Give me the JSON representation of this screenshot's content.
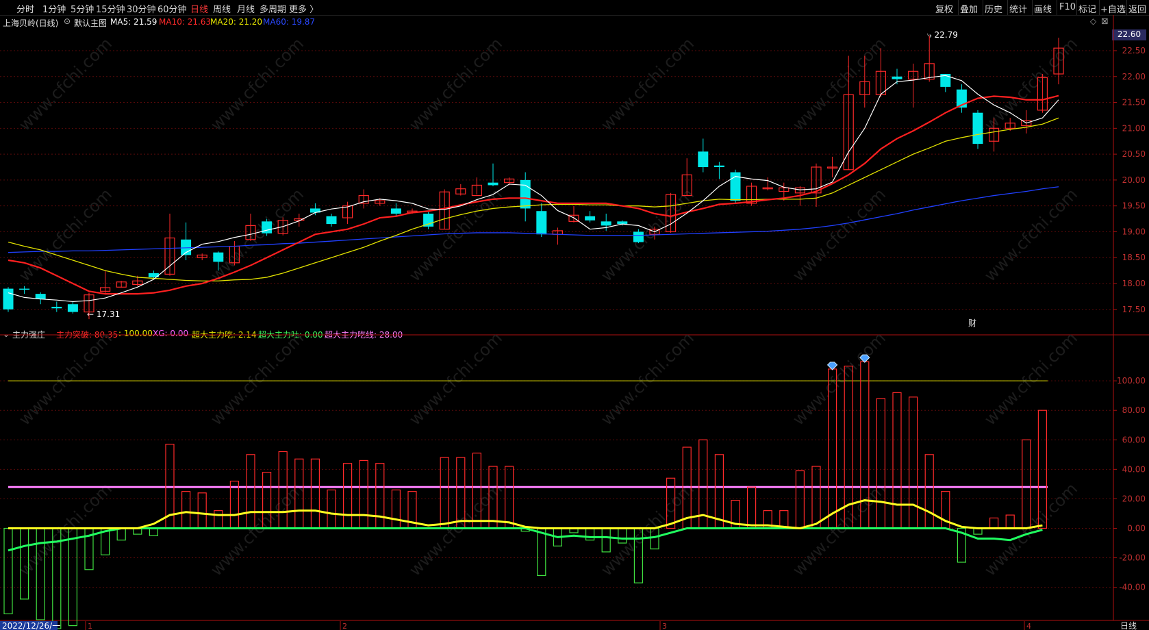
{
  "toolbar": {
    "periods": [
      "分时",
      "1分钟",
      "5分钟",
      "15分钟",
      "30分钟",
      "60分钟",
      "日线",
      "周线",
      "月线",
      "多周期",
      "更多 〉"
    ],
    "active_period": "日线",
    "tools": [
      "复权",
      "叠加",
      "历史",
      "统计",
      "画线",
      "F10",
      "标记",
      "+自选",
      "返回"
    ]
  },
  "main_header": {
    "name": "上海贝岭(日线)",
    "template": "默认主图",
    "ma5": "MA5: 21.59",
    "ma10": "MA10: 21.63",
    "ma20": "MA20: 21.20",
    "ma60": "MA60: 19.87"
  },
  "sub_header": {
    "name": "主力强庄",
    "main_break": "主力突破: 80.35",
    "main_break2": ": 100.00",
    "xg": "XG: 0.00",
    "eat": "超大主力吃: 2.14",
    "spit": "超大主力吐: 0.00",
    "eat_line": "超大主力吃线: 28.00"
  },
  "annotations": {
    "high": "22.79",
    "low": "17.31",
    "price_tag": "22.60",
    "cai": "财"
  },
  "price_axis": [
    "22.50",
    "22.00",
    "21.50",
    "21.00",
    "20.50",
    "20.00",
    "19.50",
    "19.00",
    "18.50",
    "18.00",
    "17.50"
  ],
  "osc_axis": [
    "100.00",
    "80.00",
    "60.00",
    "40.00",
    "20.00",
    "0.00",
    "-20.00",
    "-40.00"
  ],
  "date_axis": {
    "start": "2022/12/26/一",
    "m1": "1",
    "m2": "2",
    "m3": "3",
    "m4": "4",
    "period_label": "日线"
  },
  "watermark": "www.cfchi.com",
  "colors": {
    "up": "#ff2a2a",
    "down": "#00e8e8",
    "ma5": "#ffffff",
    "ma10": "#ff2020",
    "ma20": "#e0e000",
    "ma60": "#2040ff",
    "eat_line": "#ff80ff",
    "pos_bar": "#ff2a2a",
    "neg_bar": "#40e040"
  },
  "chart_data": {
    "type": "candlestick",
    "candles": [
      [
        17.9,
        17.5,
        17.93,
        17.45
      ],
      [
        17.9,
        17.88,
        17.95,
        17.8
      ],
      [
        17.8,
        17.7,
        17.83,
        17.6
      ],
      [
        17.55,
        17.52,
        17.65,
        17.45
      ],
      [
        17.6,
        17.45,
        17.65,
        17.42
      ],
      [
        17.45,
        17.78,
        17.82,
        17.31
      ],
      [
        17.85,
        17.92,
        18.25,
        17.8
      ],
      [
        17.93,
        18.03,
        18.05,
        17.92
      ],
      [
        17.98,
        18.05,
        18.15,
        17.95
      ],
      [
        18.2,
        18.12,
        18.25,
        18.08
      ],
      [
        18.18,
        18.88,
        19.35,
        18.15
      ],
      [
        18.85,
        18.55,
        19.18,
        18.45
      ],
      [
        18.5,
        18.55,
        18.58,
        18.45
      ],
      [
        18.6,
        18.42,
        18.62,
        18.25
      ],
      [
        18.4,
        18.72,
        18.82,
        18.35
      ],
      [
        18.85,
        19.12,
        19.35,
        18.82
      ],
      [
        19.2,
        18.97,
        19.25,
        18.92
      ],
      [
        18.97,
        19.22,
        19.28,
        18.93
      ],
      [
        19.22,
        19.25,
        19.35,
        19.1
      ],
      [
        19.45,
        19.37,
        19.55,
        19.32
      ],
      [
        19.3,
        19.15,
        19.35,
        19.1
      ],
      [
        19.27,
        19.5,
        19.58,
        19.15
      ],
      [
        19.55,
        19.7,
        19.82,
        19.45
      ],
      [
        19.55,
        19.6,
        19.65,
        19.5
      ],
      [
        19.45,
        19.35,
        19.55,
        19.3
      ],
      [
        19.37,
        19.4,
        19.45,
        19.35
      ],
      [
        19.35,
        19.1,
        19.38,
        19.05
      ],
      [
        19.05,
        19.77,
        19.82,
        19.05
      ],
      [
        19.73,
        19.83,
        19.92,
        19.7
      ],
      [
        19.7,
        19.9,
        20.05,
        19.72
      ],
      [
        19.95,
        19.9,
        20.32,
        19.88
      ],
      [
        19.95,
        20.02,
        20.05,
        19.9
      ],
      [
        20.0,
        19.45,
        20.15,
        19.2
      ],
      [
        19.4,
        18.95,
        19.55,
        18.9
      ],
      [
        18.95,
        19.02,
        19.08,
        18.75
      ],
      [
        19.2,
        19.32,
        19.5,
        19.18
      ],
      [
        19.3,
        19.22,
        19.4,
        19.18
      ],
      [
        19.2,
        19.12,
        19.35,
        19.02
      ],
      [
        19.2,
        19.15,
        19.22,
        19.12
      ],
      [
        19.0,
        18.8,
        19.05,
        18.78
      ],
      [
        18.95,
        19.05,
        19.1,
        18.85
      ],
      [
        19.0,
        19.72,
        19.75,
        18.98
      ],
      [
        19.7,
        20.1,
        20.42,
        19.7
      ],
      [
        20.55,
        20.25,
        20.8,
        20.15
      ],
      [
        20.28,
        20.25,
        20.35,
        20.02
      ],
      [
        20.15,
        19.6,
        20.2,
        19.55
      ],
      [
        19.55,
        19.88,
        19.95,
        19.5
      ],
      [
        19.85,
        19.85,
        20.05,
        19.8
      ],
      [
        19.78,
        19.85,
        19.95,
        19.6
      ],
      [
        19.75,
        19.85,
        19.88,
        19.5
      ],
      [
        19.75,
        20.25,
        20.32,
        19.48
      ],
      [
        20.25,
        20.25,
        20.45,
        20.05
      ],
      [
        20.2,
        21.65,
        22.4,
        20.2
      ],
      [
        21.65,
        21.9,
        22.4,
        21.4
      ],
      [
        21.65,
        22.1,
        22.55,
        21.6
      ],
      [
        22.0,
        21.95,
        22.15,
        21.85
      ],
      [
        21.95,
        22.1,
        22.25,
        21.4
      ],
      [
        21.95,
        22.25,
        22.79,
        21.9
      ],
      [
        22.05,
        21.8,
        22.05,
        21.7
      ],
      [
        21.75,
        21.4,
        21.85,
        21.3
      ],
      [
        21.3,
        20.7,
        21.35,
        20.6
      ],
      [
        20.75,
        21.0,
        21.2,
        20.55
      ],
      [
        21.0,
        21.1,
        21.2,
        20.95
      ],
      [
        21.05,
        21.15,
        21.35,
        20.9
      ],
      [
        21.35,
        21.98,
        22.05,
        21.3
      ],
      [
        22.05,
        22.55,
        22.75,
        21.85
      ]
    ],
    "ma5": [
      17.82,
      17.73,
      17.7,
      17.68,
      17.65,
      17.67,
      17.72,
      17.82,
      17.93,
      18.08,
      18.34,
      18.6,
      18.76,
      18.81,
      18.89,
      18.95,
      19.03,
      19.1,
      19.21,
      19.37,
      19.44,
      19.48,
      19.58,
      19.63,
      19.6,
      19.55,
      19.44,
      19.43,
      19.5,
      19.62,
      19.72,
      19.92,
      19.9,
      19.7,
      19.41,
      19.27,
      19.05,
      19.08,
      19.15,
      19.12,
      19.0,
      19.15,
      19.36,
      19.6,
      19.88,
      20.07,
      20.02,
      19.99,
      19.86,
      19.81,
      19.83,
      19.96,
      20.54,
      21.0,
      21.66,
      21.9,
      21.93,
      21.98,
      22.02,
      21.92,
      21.66,
      21.45,
      21.3,
      21.1,
      21.2,
      21.55
    ],
    "ma10": [
      18.45,
      18.4,
      18.3,
      18.15,
      18.0,
      17.85,
      17.8,
      17.8,
      17.8,
      17.82,
      17.87,
      17.95,
      18.0,
      18.1,
      18.22,
      18.35,
      18.5,
      18.65,
      18.8,
      18.95,
      19.0,
      19.05,
      19.15,
      19.27,
      19.3,
      19.37,
      19.4,
      19.45,
      19.52,
      19.58,
      19.63,
      19.65,
      19.65,
      19.6,
      19.55,
      19.55,
      19.55,
      19.55,
      19.5,
      19.45,
      19.35,
      19.3,
      19.38,
      19.45,
      19.53,
      19.55,
      19.58,
      19.62,
      19.65,
      19.7,
      19.78,
      19.93,
      20.1,
      20.32,
      20.6,
      20.8,
      20.95,
      21.12,
      21.3,
      21.45,
      21.58,
      21.62,
      21.6,
      21.55,
      21.55,
      21.63
    ],
    "ma20": [
      18.8,
      18.72,
      18.65,
      18.55,
      18.45,
      18.35,
      18.25,
      18.18,
      18.12,
      18.1,
      18.08,
      18.06,
      18.05,
      18.05,
      18.07,
      18.08,
      18.12,
      18.2,
      18.3,
      18.4,
      18.5,
      18.6,
      18.7,
      18.82,
      18.93,
      19.05,
      19.15,
      19.25,
      19.33,
      19.4,
      19.45,
      19.48,
      19.5,
      19.52,
      19.53,
      19.53,
      19.52,
      19.52,
      19.5,
      19.5,
      19.48,
      19.5,
      19.55,
      19.6,
      19.63,
      19.62,
      19.62,
      19.63,
      19.63,
      19.63,
      19.65,
      19.75,
      19.9,
      20.05,
      20.2,
      20.35,
      20.5,
      20.62,
      20.75,
      20.82,
      20.88,
      20.93,
      20.98,
      21.02,
      21.08,
      21.2
    ],
    "ma60": [
      18.6,
      18.61,
      18.62,
      18.62,
      18.63,
      18.63,
      18.64,
      18.65,
      18.66,
      18.67,
      18.68,
      18.69,
      18.7,
      18.71,
      18.72,
      18.74,
      18.75,
      18.77,
      18.78,
      18.8,
      18.82,
      18.84,
      18.86,
      18.88,
      18.9,
      18.92,
      18.94,
      18.96,
      18.97,
      18.98,
      18.98,
      18.98,
      18.97,
      18.96,
      18.95,
      18.94,
      18.93,
      18.93,
      18.93,
      18.93,
      18.94,
      18.95,
      18.96,
      18.97,
      18.98,
      18.99,
      19.0,
      19.01,
      19.03,
      19.05,
      19.08,
      19.12,
      19.17,
      19.23,
      19.29,
      19.35,
      19.42,
      19.48,
      19.54,
      19.6,
      19.65,
      19.7,
      19.74,
      19.78,
      19.83,
      19.87
    ],
    "bars": [
      -58,
      -48,
      -62,
      -68,
      -66,
      -28,
      -18,
      -8,
      -4,
      -5,
      57,
      25,
      24,
      12,
      32,
      50,
      38,
      52,
      47,
      47,
      26,
      44,
      46,
      44,
      26,
      25,
      0,
      48,
      48,
      51,
      42,
      42,
      -2,
      -32,
      -12,
      -3,
      -8,
      -16,
      -10,
      -37,
      -14,
      34,
      55,
      60,
      50,
      19,
      28,
      12,
      12,
      39,
      42,
      108,
      110,
      113,
      88,
      92,
      89,
      50,
      25,
      -23,
      -4,
      7,
      9,
      60,
      80
    ],
    "yellow": [
      0,
      0,
      0,
      0,
      0,
      0,
      0,
      0,
      0,
      3,
      9,
      11,
      10,
      9,
      9,
      11,
      11,
      11,
      12,
      12,
      10,
      9,
      9,
      8,
      6,
      4,
      2,
      3,
      5,
      5,
      5,
      4,
      1,
      0,
      0,
      0,
      0,
      0,
      0,
      0,
      0,
      3,
      7,
      9,
      6,
      3,
      2,
      2,
      1,
      0,
      3,
      10,
      16,
      19,
      18,
      16,
      16,
      11,
      5,
      1,
      0,
      0,
      0,
      0,
      2
    ],
    "green": [
      -15,
      -12,
      -10,
      -9,
      -7,
      -5,
      -2,
      0,
      0,
      0,
      0,
      0,
      0,
      0,
      0,
      0,
      0,
      0,
      0,
      0,
      0,
      0,
      0,
      0,
      0,
      0,
      0,
      0,
      0,
      0,
      0,
      0,
      0,
      -3,
      -6,
      -5,
      -6,
      -6,
      -7,
      -7,
      -6,
      -3,
      0,
      0,
      0,
      0,
      0,
      0,
      0,
      0,
      0,
      0,
      0,
      0,
      0,
      0,
      0,
      0,
      0,
      -3,
      -7,
      -7,
      -8,
      -4,
      -1
    ],
    "eat_line": 28,
    "upper_line": 100,
    "price_range": [
      17.1,
      22.95
    ],
    "osc_range": [
      -62,
      127
    ]
  }
}
